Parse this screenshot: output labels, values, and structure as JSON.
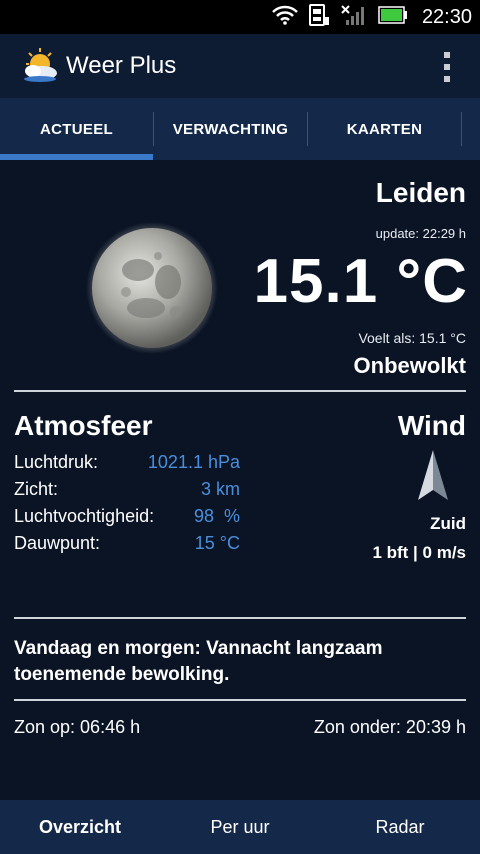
{
  "status_bar": {
    "time": "22:30",
    "icons": [
      "wifi-icon",
      "sim-card-icon",
      "no-signal-icon",
      "battery-icon"
    ],
    "battery_color": "#3ec93e"
  },
  "app": {
    "title": "Weer Plus",
    "menu_icon": "overflow-menu-icon"
  },
  "tabs": [
    {
      "label": "ACTUEEL",
      "active": true
    },
    {
      "label": "VERWACHTING",
      "active": false
    },
    {
      "label": "KAARTEN",
      "active": false
    }
  ],
  "current": {
    "city": "Leiden",
    "update": "update: 22:29 h",
    "temperature": "15.1 °C",
    "feels_like": "Voelt als: 15.1 °C",
    "condition": "Onbewolkt",
    "icon": "moon-icon"
  },
  "atmosphere": {
    "title": "Atmosfeer",
    "rows": [
      {
        "label": "Luchtdruk:",
        "value": "1021.1 hPa"
      },
      {
        "label": "Zicht:",
        "value": "3 km"
      },
      {
        "label": "Luchtvochtigheid:",
        "value": "98  %"
      },
      {
        "label": "Dauwpunt:",
        "value": "15 °C"
      }
    ]
  },
  "wind": {
    "title": "Wind",
    "direction": "Zuid",
    "speed": "1 bft | 0 m/s",
    "icon": "wind-direction-arrow-icon"
  },
  "forecast": {
    "text": "Vandaag en morgen: Vannacht langzaam toenemende bewolking."
  },
  "sun": {
    "sunrise": "Zon op: 06:46 h",
    "sunset": "Zon onder: 20:39 h"
  },
  "bottom_nav": [
    {
      "label": "Overzicht",
      "active": true
    },
    {
      "label": "Per uur",
      "active": false
    },
    {
      "label": "Radar",
      "active": false
    }
  ],
  "colors": {
    "background": "#0b1424",
    "bar": "#14294a",
    "accent": "#3a78c8",
    "value_blue": "#4a8fdc"
  }
}
